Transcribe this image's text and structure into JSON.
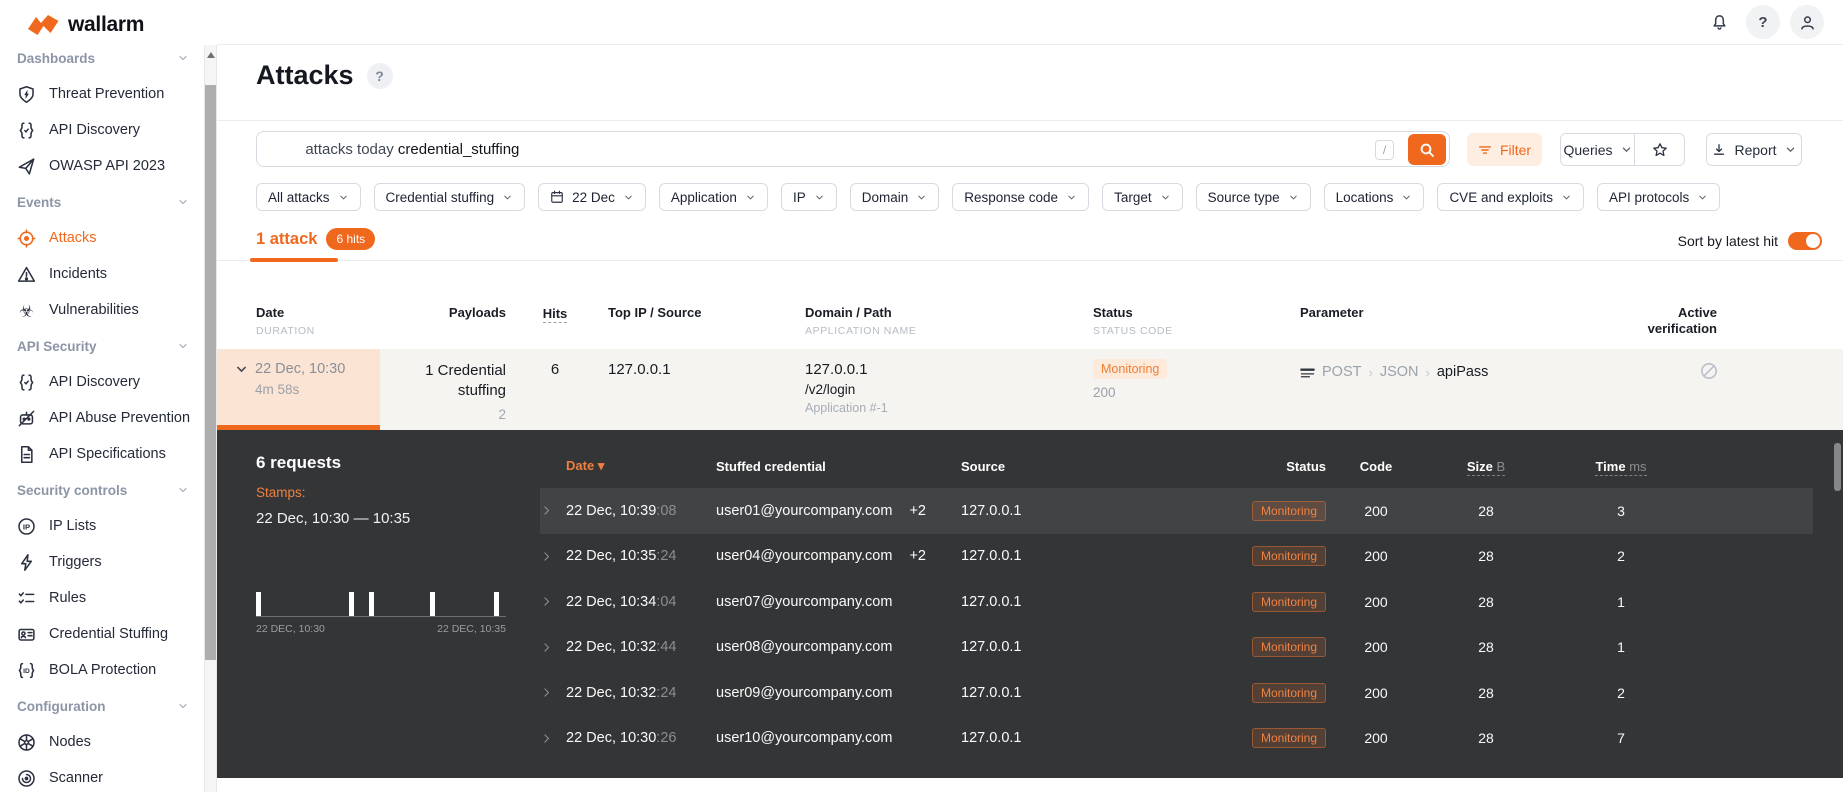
{
  "accent": "#f0681e",
  "brand": {
    "logo_text": "wallarm"
  },
  "topbar": {
    "icons": [
      "notifications-bell",
      "help",
      "user"
    ]
  },
  "sidebar": {
    "sections": [
      {
        "label": "Dashboards",
        "items": [
          {
            "label": "Threat Prevention",
            "icon": "shield"
          },
          {
            "label": "API Discovery",
            "icon": "braces"
          },
          {
            "label": "OWASP API 2023",
            "icon": "plane"
          }
        ]
      },
      {
        "label": "Events",
        "items": [
          {
            "label": "Attacks",
            "icon": "target",
            "active": true
          },
          {
            "label": "Incidents",
            "icon": "warning"
          },
          {
            "label": "Vulnerabilities",
            "icon": "biohazard"
          }
        ]
      },
      {
        "label": "API Security",
        "items": [
          {
            "label": "API Discovery",
            "icon": "braces"
          },
          {
            "label": "API Abuse Prevention",
            "icon": "bot"
          },
          {
            "label": "API Specifications",
            "icon": "doc"
          }
        ]
      },
      {
        "label": "Security controls",
        "items": [
          {
            "label": "IP Lists",
            "icon": "ip"
          },
          {
            "label": "Triggers",
            "icon": "bolt"
          },
          {
            "label": "Rules",
            "icon": "checklist"
          },
          {
            "label": "Credential Stuffing",
            "icon": "idcard"
          },
          {
            "label": "BOLA Protection",
            "icon": "bola"
          }
        ]
      },
      {
        "label": "Configuration",
        "items": [
          {
            "label": "Nodes",
            "icon": "nodes"
          },
          {
            "label": "Scanner",
            "icon": "scanner"
          }
        ]
      }
    ]
  },
  "page": {
    "title": "Attacks"
  },
  "search": {
    "tokens_muted": "attacks today ",
    "tokens_strong": "credential_stuffing",
    "shortcut": "/"
  },
  "toolbar": {
    "filter": "Filter",
    "queries": "Queries",
    "report": "Report"
  },
  "filter_chips": [
    {
      "label": "All attacks"
    },
    {
      "label": "Credential stuffing"
    },
    {
      "label": "22 Dec",
      "calendar": true
    },
    {
      "label": "Application"
    },
    {
      "label": "IP"
    },
    {
      "label": "Domain"
    },
    {
      "label": "Response code"
    },
    {
      "label": "Target"
    },
    {
      "label": "Source type"
    },
    {
      "label": "Locations"
    },
    {
      "label": "CVE and exploits"
    },
    {
      "label": "API protocols"
    }
  ],
  "results": {
    "attack_tab": "1 attack",
    "hits_badge": "6 hits",
    "sort_label": "Sort by latest hit",
    "sort_on": true
  },
  "attack_table": {
    "headers": {
      "date": "Date",
      "date_sub": "DURATION",
      "payloads": "Payloads",
      "hits": "Hits",
      "top_ip": "Top IP / Source",
      "domain": "Domain / Path",
      "domain_sub": "APPLICATION NAME",
      "status": "Status",
      "status_sub": "STATUS CODE",
      "parameter": "Parameter",
      "verification": "Active verification"
    },
    "row": {
      "date": "22 Dec, 10:30",
      "duration": "4m 58s",
      "payloads": "1 Credential stuffing",
      "payloads_sub": "2",
      "hits": "6",
      "top_ip": "127.0.0.1",
      "domain": "127.0.0.1",
      "path": "/v2/login",
      "application": "Application #-1",
      "status": "Monitoring",
      "status_code": "200",
      "param_method": "POST",
      "param_format": "JSON",
      "param_name": "apiPass"
    }
  },
  "details": {
    "requests_title": "6 requests",
    "stamps_label": "Stamps:",
    "stamps_range": "22 Dec, 10:30 — 10:35",
    "histogram": {
      "start": "22 DEC, 10:30",
      "end": "22 DEC, 10:35",
      "bars_pct": [
        0,
        38,
        46,
        71,
        97
      ]
    },
    "table": {
      "headers": {
        "date": "Date",
        "credential": "Stuffed credential",
        "source": "Source",
        "status": "Status",
        "code": "Code",
        "size": "Size",
        "size_unit": "B",
        "time": "Time",
        "time_unit": "ms"
      },
      "rows": [
        {
          "time": "22 Dec, 10:39",
          "seconds": ":08",
          "credential": "user01@yourcompany.com",
          "extra": "+2",
          "source": "127.0.0.1",
          "status": "Monitoring",
          "code": "200",
          "size": "28",
          "duration": "3",
          "selected": true
        },
        {
          "time": "22 Dec, 10:35",
          "seconds": ":24",
          "credential": "user04@yourcompany.com",
          "extra": "+2",
          "source": "127.0.0.1",
          "status": "Monitoring",
          "code": "200",
          "size": "28",
          "duration": "2"
        },
        {
          "time": "22 Dec, 10:34",
          "seconds": ":04",
          "credential": "user07@yourcompany.com",
          "source": "127.0.0.1",
          "status": "Monitoring",
          "code": "200",
          "size": "28",
          "duration": "1"
        },
        {
          "time": "22 Dec, 10:32",
          "seconds": ":44",
          "credential": "user08@yourcompany.com",
          "source": "127.0.0.1",
          "status": "Monitoring",
          "code": "200",
          "size": "28",
          "duration": "1"
        },
        {
          "time": "22 Dec, 10:32",
          "seconds": ":24",
          "credential": "user09@yourcompany.com",
          "source": "127.0.0.1",
          "status": "Monitoring",
          "code": "200",
          "size": "28",
          "duration": "2"
        },
        {
          "time": "22 Dec, 10:30",
          "seconds": ":26",
          "credential": "user10@yourcompany.com",
          "source": "127.0.0.1",
          "status": "Monitoring",
          "code": "200",
          "size": "28",
          "duration": "7"
        }
      ]
    }
  }
}
